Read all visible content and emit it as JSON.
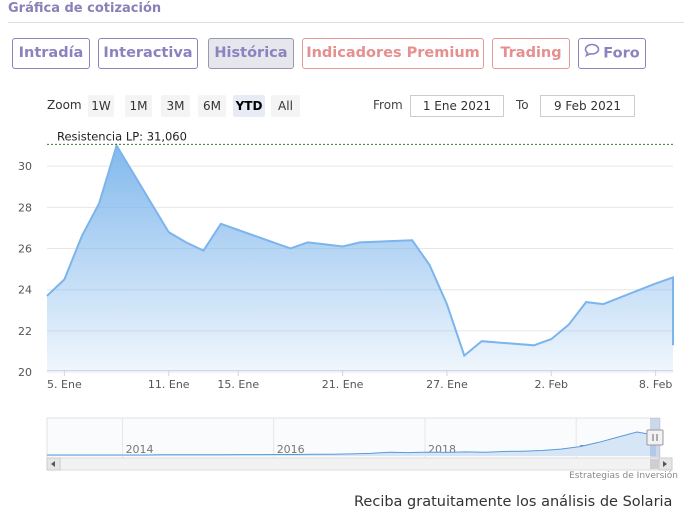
{
  "section_title": "Gráfica de cotización",
  "tabs": [
    {
      "label": "Intradía",
      "style": "purple"
    },
    {
      "label": "Interactiva",
      "style": "purple"
    },
    {
      "label": "Histórica",
      "style": "active"
    },
    {
      "label": "Indicadores Premium",
      "style": "red"
    },
    {
      "label": "Trading",
      "style": "red"
    },
    {
      "label": "Foro",
      "style": "purple",
      "icon": "chat-bubble-icon"
    }
  ],
  "zoom": {
    "label": "Zoom",
    "options": [
      "1W",
      "1M",
      "3M",
      "6M",
      "YTD",
      "All"
    ],
    "selected": "YTD"
  },
  "range": {
    "from_label": "From",
    "from_value": "1 Ene 2021",
    "to_label": "To",
    "to_value": "9 Feb 2021"
  },
  "chart_data": {
    "type": "area",
    "x_start": "2021-01-04",
    "x_end": "2021-02-09",
    "dates": [
      "2021-01-04",
      "2021-01-05",
      "2021-01-06",
      "2021-01-07",
      "2021-01-08",
      "2021-01-11",
      "2021-01-12",
      "2021-01-13",
      "2021-01-14",
      "2021-01-15",
      "2021-01-18",
      "2021-01-19",
      "2021-01-20",
      "2021-01-21",
      "2021-01-22",
      "2021-01-25",
      "2021-01-26",
      "2021-01-27",
      "2021-01-28",
      "2021-01-29",
      "2021-02-01",
      "2021-02-02",
      "2021-02-03",
      "2021-02-04",
      "2021-02-05",
      "2021-02-08",
      "2021-02-09"
    ],
    "values": [
      23.7,
      24.5,
      26.6,
      28.2,
      31.0,
      26.8,
      26.3,
      25.9,
      27.2,
      26.9,
      26.0,
      26.3,
      26.2,
      26.1,
      26.3,
      26.4,
      25.2,
      23.3,
      20.8,
      21.5,
      21.3,
      21.6,
      22.3,
      23.4,
      23.3,
      24.3,
      24.6
    ],
    "last_value": 21.3,
    "ylim": [
      20,
      31
    ],
    "yticks": [
      20,
      22,
      24,
      26,
      28,
      30
    ],
    "xtick_labels": [
      {
        "label": "5. Ene",
        "date": "2021-01-05"
      },
      {
        "label": "11. Ene",
        "date": "2021-01-11"
      },
      {
        "label": "15. Ene",
        "date": "2021-01-15"
      },
      {
        "label": "21. Ene",
        "date": "2021-01-21"
      },
      {
        "label": "27. Ene",
        "date": "2021-01-27"
      },
      {
        "label": "2. Feb",
        "date": "2021-02-02"
      },
      {
        "label": "8. Feb",
        "date": "2021-02-08"
      }
    ],
    "resistance": {
      "label": "Resistencia LP: 31,060",
      "value": 31.06,
      "color": "#2e7d32"
    },
    "series_color": "#7cb5ec",
    "navigator": {
      "years": [
        "2014",
        "2016",
        "2018",
        "2020"
      ],
      "xlim": [
        "2013-01-01",
        "2021-02-09"
      ],
      "values": [
        0.6,
        0.6,
        0.6,
        0.6,
        0.6,
        0.6,
        0.7,
        0.7,
        0.7,
        0.7,
        0.8,
        0.8,
        0.9,
        0.9,
        1.0,
        1.0,
        1.2,
        1.5,
        2.2,
        2.0,
        2.3,
        2.1,
        2.4,
        2.2,
        2.6,
        2.8,
        3.2,
        4.0,
        5.5,
        8.0,
        11.0,
        14.0,
        12.0
      ]
    }
  },
  "credit": "Estrategias de Inversión",
  "promo_text": "Reciba gratuitamente los análisis de Solaria"
}
